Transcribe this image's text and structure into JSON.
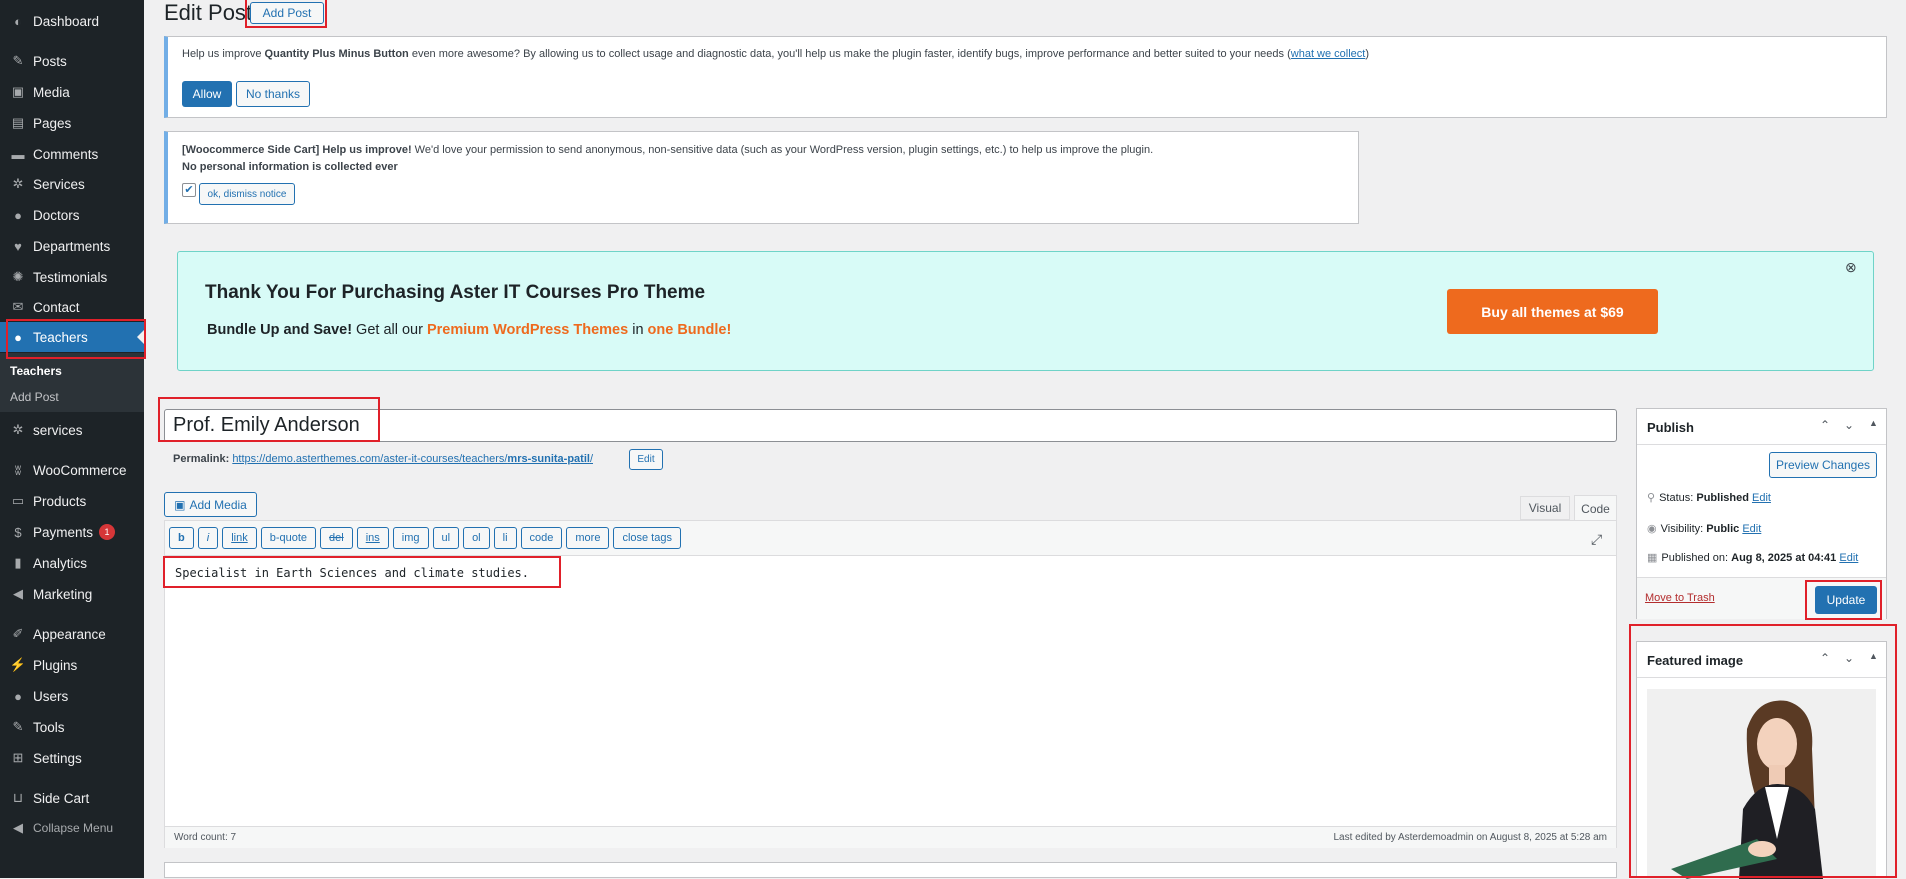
{
  "sidebar": {
    "items": [
      {
        "label": "Dashboard",
        "icon": "dashboard-icon",
        "glyph": "◐"
      },
      {
        "label": "Posts",
        "icon": "pushpin-icon",
        "glyph": "✎"
      },
      {
        "label": "Media",
        "icon": "media-icon",
        "glyph": "▣"
      },
      {
        "label": "Pages",
        "icon": "pages-icon",
        "glyph": "▤"
      },
      {
        "label": "Comments",
        "icon": "comments-icon",
        "glyph": "▬"
      },
      {
        "label": "Services",
        "icon": "gear-icon",
        "glyph": "✲"
      },
      {
        "label": "Doctors",
        "icon": "user-icon",
        "glyph": "●"
      },
      {
        "label": "Departments",
        "icon": "heart-icon",
        "glyph": "♥"
      },
      {
        "label": "Testimonials",
        "icon": "groups-icon",
        "glyph": "✺"
      },
      {
        "label": "Contact",
        "icon": "email-icon",
        "glyph": "✉"
      },
      {
        "label": "Teachers",
        "icon": "user-icon",
        "glyph": "●"
      },
      {
        "label": "services",
        "icon": "gear-icon",
        "glyph": "✲"
      },
      {
        "label": "WooCommerce",
        "icon": "woocommerce-icon",
        "glyph": "ʬ"
      },
      {
        "label": "Products",
        "icon": "archive-icon",
        "glyph": "▭"
      },
      {
        "label": "Payments",
        "icon": "payments-icon",
        "glyph": "$",
        "badge": "1"
      },
      {
        "label": "Analytics",
        "icon": "chart-bar-icon",
        "glyph": "▮"
      },
      {
        "label": "Marketing",
        "icon": "megaphone-icon",
        "glyph": "◀"
      },
      {
        "label": "Appearance",
        "icon": "paintbrush-icon",
        "glyph": "✐"
      },
      {
        "label": "Plugins",
        "icon": "plugin-icon",
        "glyph": "⚡"
      },
      {
        "label": "Users",
        "icon": "users-icon",
        "glyph": "●"
      },
      {
        "label": "Tools",
        "icon": "wrench-icon",
        "glyph": "✎"
      },
      {
        "label": "Settings",
        "icon": "settings-icon",
        "glyph": "⊞"
      },
      {
        "label": "Side Cart",
        "icon": "cart-icon",
        "glyph": "⊔"
      },
      {
        "label": "Collapse Menu",
        "icon": "collapse-icon",
        "glyph": "◀"
      }
    ],
    "submenu": {
      "current": "Teachers",
      "add": "Add Post"
    }
  },
  "header": {
    "title": "Edit Post",
    "add_button": "Add Post"
  },
  "notice1": {
    "prefix": "Help us improve ",
    "plugin": "Quantity Plus Minus Button",
    "text": " even more awesome? By allowing us to collect usage and diagnostic data, you'll help us make the plugin faster, identify bugs, improve performance and better suited to your needs (",
    "link": "what we collect",
    "suffix": ")",
    "allow": "Allow",
    "no_thanks": "No thanks"
  },
  "notice2": {
    "bold": "[Woocommerce Side Cart] Help us improve!",
    "text": " We'd love your permission to send anonymous, non-sensitive data (such as your WordPress version, plugin settings, etc.) to help us improve the plugin.",
    "line2": "No personal information is collected ever",
    "dismiss": "ok, dismiss notice"
  },
  "promo": {
    "title": "Thank You For Purchasing Aster IT Courses Pro Theme",
    "bundle_bold": "Bundle Up and Save!",
    "get": " Get all our ",
    "premium": "Premium WordPress Themes",
    "in": " in ",
    "one_bundle": "one Bundle!",
    "button": "Buy all themes at $69",
    "close": "⊗"
  },
  "editor": {
    "post_title": "Prof. Emily Anderson",
    "permalink_label": "Permalink:",
    "permalink_base": "https://demo.asterthemes.com/aster-it-courses/teachers/",
    "permalink_slug": "mrs-sunita-patil",
    "permalink_end": "/",
    "permalink_edit": "Edit",
    "add_media": "Add Media",
    "tab_visual": "Visual",
    "tab_code": "Code",
    "quicktags": [
      "b",
      "i",
      "link",
      "b-quote",
      "del",
      "ins",
      "img",
      "ul",
      "ol",
      "li",
      "code",
      "more",
      "close tags"
    ],
    "content": "Specialist in Earth Sciences and climate studies.",
    "word_count": "Word count: 7",
    "last_edited": "Last edited by Asterdemoadmin on August 8, 2025 at 5:28 am"
  },
  "publish": {
    "title": "Publish",
    "preview": "Preview Changes",
    "status_label": "Status: ",
    "status_value": "Published",
    "visibility_label": "Visibility: ",
    "visibility_value": "Public",
    "published_label": "Published on: ",
    "published_value": "Aug 8, 2025 at 04:41",
    "edit": "Edit",
    "trash": "Move to Trash",
    "update": "Update"
  },
  "featured": {
    "title": "Featured image"
  },
  "colors": {
    "accent": "#2271b1",
    "sidebar": "#1d2327",
    "promo_bg": "#d8fbf7",
    "promo_btn": "#ee6a1e",
    "highlight": "#e0202a"
  }
}
